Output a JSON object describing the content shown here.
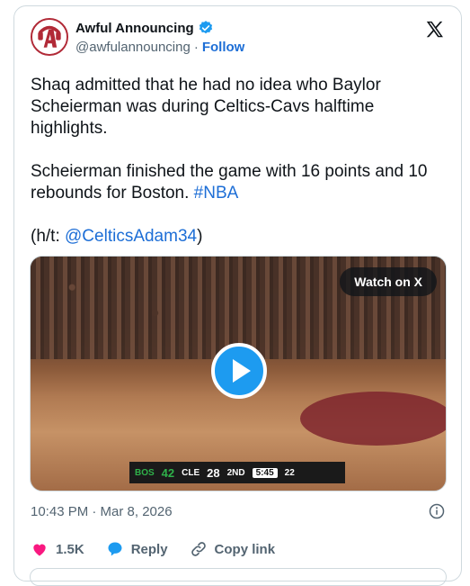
{
  "tweet": {
    "display_name": "Awful Announcing",
    "handle": "@awfulannouncing",
    "separator": "·",
    "follow_label": "Follow",
    "paragraph1": "Shaq admitted that he had no idea who Baylor Scheierman was during Celtics-Cavs halftime highlights.",
    "paragraph2_text": "Scheierman finished the game with 16 points and 10 rebounds for Boston. ",
    "paragraph2_hashtag": "#NBA",
    "paragraph3_prefix": "(h/t: ",
    "paragraph3_mention": "@CelticsAdam34",
    "paragraph3_suffix": ")",
    "timestamp": "10:43 PM · Mar 8, 2026"
  },
  "media": {
    "watch_label": "Watch on X",
    "scorebug": {
      "team1": "BOS",
      "score1": "42",
      "team2": "CLE",
      "score2": "28",
      "period": "2ND",
      "clock": "5:45",
      "shot_clock": "22"
    }
  },
  "actions": {
    "likes": "1.5K",
    "reply_label": "Reply",
    "copy_link_label": "Copy link"
  },
  "colors": {
    "accent": "#1d9bf0",
    "link": "#1d6ed6",
    "like": "#f91880",
    "muted": "#536471"
  },
  "icons": [
    "verified-badge-icon",
    "x-logo-icon",
    "play-icon",
    "info-icon",
    "heart-icon",
    "reply-icon",
    "link-icon"
  ]
}
